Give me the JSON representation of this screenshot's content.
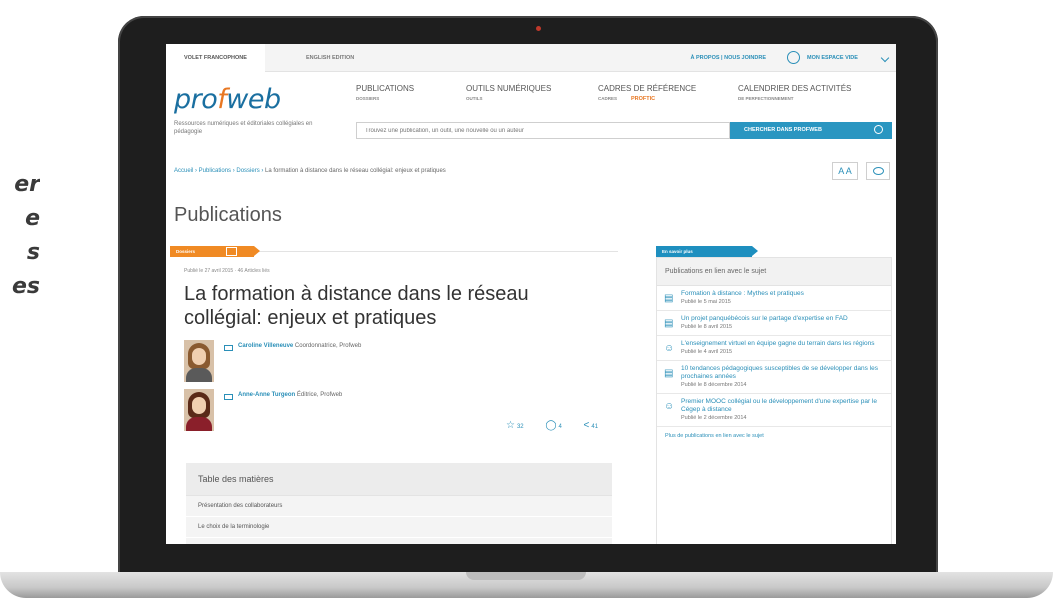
{
  "side_text": [
    "er",
    "e",
    "s",
    "es"
  ],
  "topbar": {
    "tab_active": "Volet francophone",
    "tab_alt": "English edition",
    "links": "À propos | Nous joindre",
    "user": "Mon espace vide"
  },
  "logo": {
    "part1": "pro",
    "accent": "f",
    "part2": "web"
  },
  "tagline": "Ressources numériques et éditoriales collégiales en pédagogie",
  "nav": [
    {
      "label": "Publications",
      "sub": "Dossiers"
    },
    {
      "label": "Outils numériques",
      "sub": "Outils"
    },
    {
      "label": "Cadres de référence",
      "sub": "Cadres",
      "badge": "ProfTIC"
    },
    {
      "label": "Calendrier des activités",
      "sub": "de perfectionnement"
    }
  ],
  "search": {
    "placeholder": "Trouvez une publication, un outil, une nouvelle ou un auteur",
    "button": "Chercher dans Profweb"
  },
  "breadcrumb": {
    "trail": "Accueil › Publications › Dossiers › ",
    "current": "La formation à distance dans le réseau collégial: enjeux et pratiques"
  },
  "tools": {
    "text_size": "A A"
  },
  "page_title": "Publications",
  "article": {
    "tag": "Dossiers",
    "meta": "Publié le 27 avril 2015 · 46 Articles liés",
    "title": "La formation à distance dans le réseau collégial: enjeux et pratiques",
    "authors": [
      {
        "name": "Caroline Villeneuve",
        "role": "Coordonnatrice, Profweb"
      },
      {
        "name": "Anne-Anne Turgeon",
        "role": "Éditrice, Profweb"
      }
    ],
    "share": {
      "favorites": "32",
      "comments": "4",
      "shares": "41"
    }
  },
  "toc": {
    "title": "Table des matières",
    "items": [
      "Présentation des collaborateurs",
      "Le choix de la terminologie"
    ]
  },
  "sidebar": {
    "ribbon": "En savoir plus",
    "heading": "Publications en lien avec le sujet",
    "items": [
      {
        "title": "Formation à distance : Mythes et pratiques",
        "date": "Publié le 5 mai 2015",
        "icon": "document-icon"
      },
      {
        "title": "Un projet panquébécois sur le partage d'expertise en FAD",
        "date": "Publié le 8 avril 2015",
        "icon": "document-icon"
      },
      {
        "title": "L'enseignement virtuel en équipe gagne du terrain dans les régions",
        "date": "Publié le 4 avril 2015",
        "icon": "people-icon"
      },
      {
        "title": "10 tendances pédagogiques susceptibles de se développer dans les prochaines années",
        "date": "Publié le 8 décembre 2014",
        "icon": "document-icon"
      },
      {
        "title": "Premier MOOC collégial ou le développement d'une expertise par le Cégep à distance",
        "date": "Publié le 2 décembre 2014",
        "icon": "people-icon"
      }
    ],
    "more": "Plus de publications en lien avec le sujet"
  }
}
